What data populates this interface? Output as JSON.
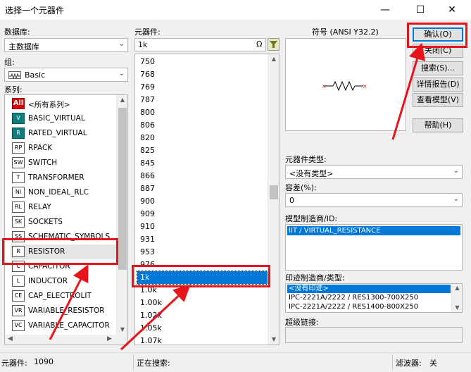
{
  "window": {
    "title": "选择一个元器件",
    "minimize_glyph": "—",
    "maximize_glyph": "☐",
    "close_glyph": "✕"
  },
  "database": {
    "label": "数据库:",
    "value": "主数据库"
  },
  "group": {
    "label": "组:",
    "value": "Basic"
  },
  "family": {
    "label": "系列:",
    "items": [
      {
        "icon": "All",
        "label": "<所有系列>"
      },
      {
        "icon": "V",
        "label": "BASIC_VIRTUAL"
      },
      {
        "icon": "R",
        "label": "RATED_VIRTUAL"
      },
      {
        "icon": "RP",
        "label": "RPACK"
      },
      {
        "icon": "SW",
        "label": "SWITCH"
      },
      {
        "icon": "T",
        "label": "TRANSFORMER"
      },
      {
        "icon": "NI",
        "label": "NON_IDEAL_RLC"
      },
      {
        "icon": "RL",
        "label": "RELAY"
      },
      {
        "icon": "SK",
        "label": "SOCKETS"
      },
      {
        "icon": "SS",
        "label": "SCHEMATIC_SYMBOLS"
      },
      {
        "icon": "R",
        "label": "RESISTOR"
      },
      {
        "icon": "C",
        "label": "CAPACITOR"
      },
      {
        "icon": "L",
        "label": "INDUCTOR"
      },
      {
        "icon": "CE",
        "label": "CAP_ELECTROLIT"
      },
      {
        "icon": "VR",
        "label": "VARIABLE_RESISTOR"
      },
      {
        "icon": "VC",
        "label": "VARIABLE_CAPACITOR"
      }
    ]
  },
  "component": {
    "label": "元器件:",
    "search_value": "1k",
    "omega_glyph": "Ω",
    "items": [
      "750",
      "768",
      "769",
      "787",
      "800",
      "806",
      "820",
      "825",
      "845",
      "866",
      "887",
      "900",
      "909",
      "910",
      "931",
      "953",
      "976",
      "1k",
      "1.0k",
      "1.00k",
      "1.02k",
      "1.05k",
      "1.07k"
    ]
  },
  "symbol": {
    "label": "符号 (ANSI Y32.2)"
  },
  "buttons": {
    "ok": "确认(O)",
    "close": "关闭(C)",
    "search": "搜索(S)...",
    "detail": "详情报告(D)",
    "model": "查看模型(V)",
    "help": "帮助(H)"
  },
  "component_type": {
    "label": "元器件类型:",
    "value": "<没有类型>"
  },
  "tolerance": {
    "label": "容差(%):",
    "value": "0"
  },
  "model_manufacturer": {
    "label": "模型制造商/ID:",
    "value": "IIT / VIRTUAL_RESISTANCE"
  },
  "footprint": {
    "label": "印迹制造商/类型:",
    "items": [
      "<没有印迹>",
      "IPC-2221A/2222 / RES1300-700X250",
      "IPC-2221A/2222 / RES1400-800X250"
    ]
  },
  "hyperlink": {
    "label": "超级链接:"
  },
  "status": {
    "count_label": "元器件:",
    "count_value": "1090",
    "searching_label": "正在搜索:",
    "filter_label": "滤波器:",
    "filter_value": "关"
  },
  "colors": {
    "highlight": "#e8141b",
    "selection": "#0078d7"
  }
}
